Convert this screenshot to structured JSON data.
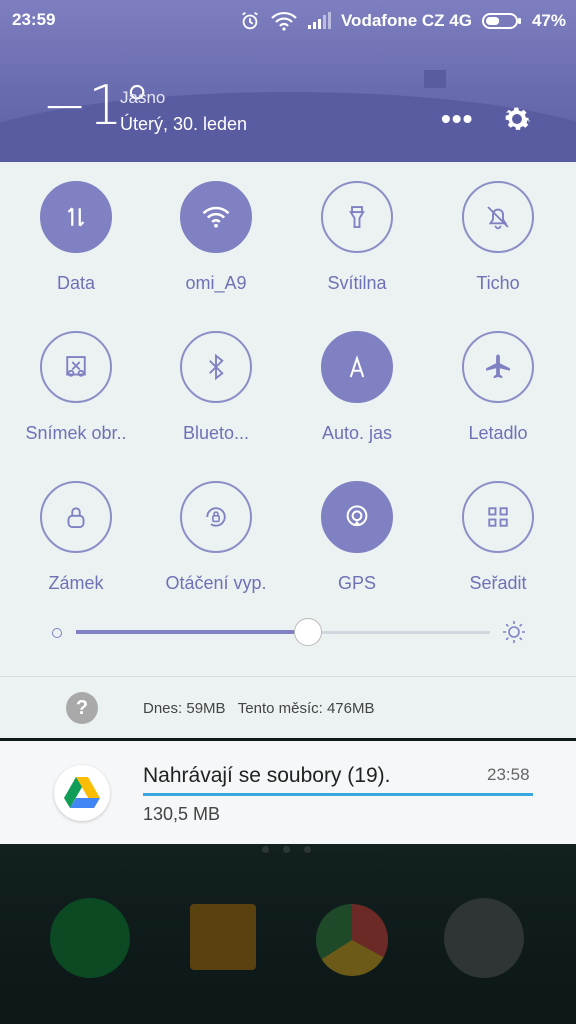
{
  "status": {
    "time": "23:59",
    "carrier": "Vodafone CZ 4G",
    "battery": "47%",
    "battery_level": 0.47
  },
  "weather": {
    "temperature": "−1°",
    "condition": "Jasno",
    "date": "Úterý, 30. leden"
  },
  "header": {
    "more_label": "•••"
  },
  "toggles": [
    {
      "label": "Data",
      "on": true,
      "icon": "data-icon"
    },
    {
      "label": "omi_A9",
      "on": true,
      "icon": "wifi-icon"
    },
    {
      "label": "Svítilna",
      "on": false,
      "icon": "flashlight-icon"
    },
    {
      "label": "Ticho",
      "on": false,
      "icon": "silent-bell-icon"
    },
    {
      "label": "Snímek obr..",
      "on": false,
      "icon": "screenshot-icon"
    },
    {
      "label": "Blueto...",
      "on": false,
      "icon": "bluetooth-icon"
    },
    {
      "label": "Auto. jas",
      "on": true,
      "icon": "auto-brightness-icon"
    },
    {
      "label": "Letadlo",
      "on": false,
      "icon": "airplane-icon"
    },
    {
      "label": "Zámek",
      "on": false,
      "icon": "lock-icon"
    },
    {
      "label": "Otáčení vyp.",
      "on": false,
      "icon": "rotation-lock-icon"
    },
    {
      "label": "GPS",
      "on": true,
      "icon": "gps-icon"
    },
    {
      "label": "Seřadit",
      "on": false,
      "icon": "grid-icon"
    }
  ],
  "brightness": {
    "level": 0.56
  },
  "usage": {
    "help_glyph": "?",
    "text": "Dnes: 59MB   Tento měsíc: 476MB"
  },
  "notification": {
    "title": "Nahrávají se soubory (19).",
    "time": "23:58",
    "size": "130,5 MB",
    "progress": 1.0
  },
  "colors": {
    "accent": "#7f81c2",
    "header": "#6a6cb0",
    "panel": "#ecf2f2",
    "progress": "#3aa7e0"
  }
}
